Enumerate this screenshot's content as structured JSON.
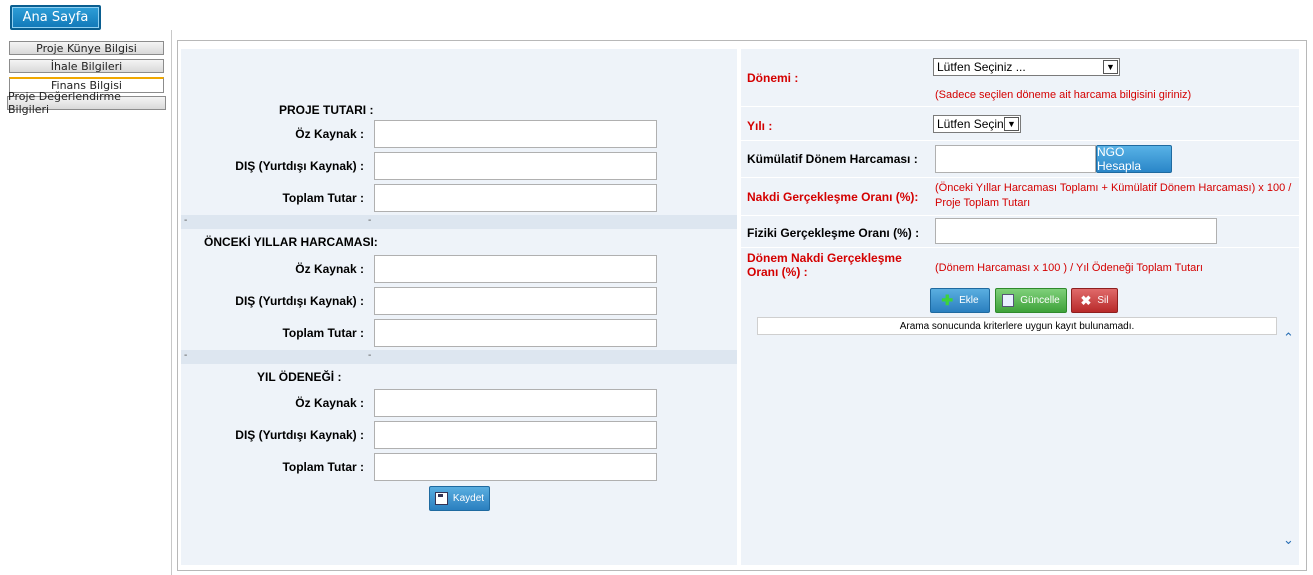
{
  "nav": {
    "home": "Ana Sayfa",
    "items": [
      "Proje Künye Bilgisi",
      "İhale Bilgileri",
      "Finans Bilgisi",
      "Proje Değerlendirme Bilgileri"
    ]
  },
  "left": {
    "sections": [
      {
        "title": "PROJE TUTARI :",
        "fields": [
          "Öz Kaynak :",
          "DIŞ (Yurtdışı Kaynak) :",
          "Toplam Tutar :"
        ]
      },
      {
        "title": "ÖNCEKİ YILLAR HARCAMASI:",
        "fields": [
          "Öz Kaynak :",
          "DIŞ (Yurtdışı Kaynak) :",
          "Toplam Tutar :"
        ]
      },
      {
        "title": "YIL ÖDENEĞİ :",
        "fields": [
          "Öz Kaynak :",
          "DIŞ (Yurtdışı Kaynak) :",
          "Toplam Tutar :"
        ]
      }
    ],
    "divider_mark": "-",
    "save_label": "Kaydet"
  },
  "right": {
    "donem_label": "Dönemi :",
    "donem_value": "Lütfen Seçiniz ...",
    "donem_hint": "(Sadece seçilen döneme ait harcama bilgisini giriniz)",
    "yil_label": "Yılı :",
    "yil_value": "Lütfen Seçiniz",
    "kumulatif_label": "Kümülatif Dönem Harcaması :",
    "ngo_button": "NGO Hesapla",
    "nakdi_label": "Nakdi Gerçekleşme Oranı (%):",
    "nakdi_formula": "(Önceki Yıllar Harcaması Toplamı + Kümülatif Dönem Harcaması) x 100 / Proje Toplam Tutarı",
    "fiziki_label": "Fiziki Gerçekleşme Oranı (%) :",
    "donem_nakdi_label": "Dönem Nakdi Gerçekleşme Oranı (%) :",
    "donem_nakdi_formula": "(Dönem Harcaması x 100 ) / Yıl Ödeneği Toplam Tutarı",
    "add_label": "Ekle",
    "update_label": "Güncelle",
    "delete_label": "Sil",
    "empty_message": "Arama sonucunda kriterlere uygun kayıt bulunamadı."
  },
  "colors": {
    "accent": "#1178b8",
    "red": "#d40000",
    "panel_bg": "#eef3f9"
  }
}
